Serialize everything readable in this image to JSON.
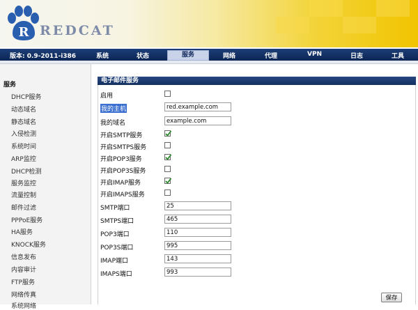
{
  "header": {
    "brand": "REDCAT"
  },
  "nav": {
    "version": "版本: 0.9-2011-i386",
    "items": [
      "系统",
      "状态",
      "服务",
      "网络",
      "代理",
      "VPN",
      "日志",
      "工具"
    ],
    "active": "服务"
  },
  "sidebar": {
    "heading": "服务",
    "items": [
      "DHCP服务",
      "动态域名",
      "静态域名",
      "入侵检测",
      "系统时间",
      "ARP监控",
      "DHCP检测",
      "服务监控",
      "流量控制",
      "邮件过滤",
      "PPPoE服务",
      "HA服务",
      "KNOCK服务",
      "信息发布",
      "内容审计",
      "FTP服务",
      "网络传真",
      "系统网络"
    ]
  },
  "panel": {
    "title": "电子邮件服务",
    "rows": [
      {
        "label": "启用",
        "type": "checkbox",
        "checked": false
      },
      {
        "label": "我的主机",
        "type": "text",
        "value": "red.example.com",
        "selected": true
      },
      {
        "label": "我的域名",
        "type": "text",
        "value": "example.com"
      },
      {
        "label": "开启SMTP服务",
        "type": "checkbox",
        "checked": true
      },
      {
        "label": "开启SMTPS服务",
        "type": "checkbox",
        "checked": false
      },
      {
        "label": "开启POP3服务",
        "type": "checkbox",
        "checked": true
      },
      {
        "label": "开启POP3S服务",
        "type": "checkbox",
        "checked": false
      },
      {
        "label": "开启IMAP服务",
        "type": "checkbox",
        "checked": true
      },
      {
        "label": "开启IMAPS服务",
        "type": "checkbox",
        "checked": false
      },
      {
        "label": "SMTP端口",
        "type": "text",
        "value": "25"
      },
      {
        "label": "SMTPS端口",
        "type": "text",
        "value": "465"
      },
      {
        "label": "POP3端口",
        "type": "text",
        "value": "110"
      },
      {
        "label": "POP3S端口",
        "type": "text",
        "value": "995"
      },
      {
        "label": "IMAP端口",
        "type": "text",
        "value": "143"
      },
      {
        "label": "IMAPS端口",
        "type": "text",
        "value": "993"
      }
    ],
    "save_label": "保存"
  },
  "colors": {
    "nav_bg": "#0c2654",
    "panel_title_bg": "#13305f",
    "check_green": "#2a8a2a",
    "banner_yellow": "#f1c400"
  }
}
